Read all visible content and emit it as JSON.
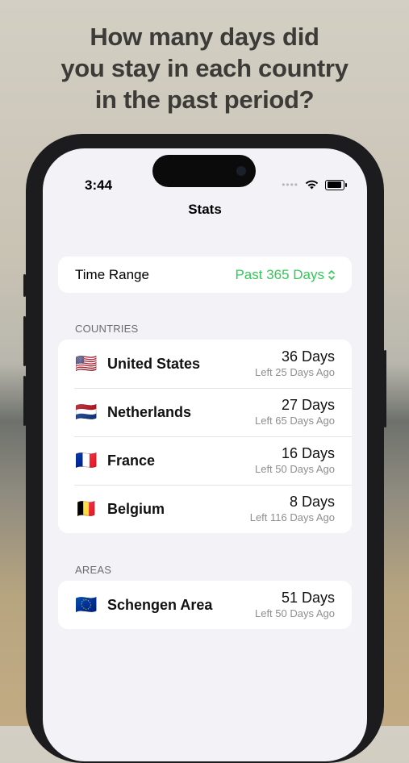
{
  "headline": {
    "line1": "How many days did",
    "line2": "you stay in each country",
    "line3": "in the past period?"
  },
  "status_bar": {
    "time": "3:44",
    "signal_dots": "••••",
    "wifi_icon": "wifi-icon",
    "battery_icon": "battery-icon"
  },
  "nav": {
    "title": "Stats"
  },
  "time_range": {
    "label": "Time Range",
    "value": "Past 365 Days",
    "accent_color": "#34c759"
  },
  "countries": {
    "header": "COUNTRIES",
    "items": [
      {
        "flag": "🇺🇸",
        "name": "United States",
        "days": "36 Days",
        "left": "Left 25 Days Ago"
      },
      {
        "flag": "🇳🇱",
        "name": "Netherlands",
        "days": "27 Days",
        "left": "Left 65 Days Ago"
      },
      {
        "flag": "🇫🇷",
        "name": "France",
        "days": "16 Days",
        "left": "Left 50 Days Ago"
      },
      {
        "flag": "🇧🇪",
        "name": "Belgium",
        "days": "8 Days",
        "left": "Left 116 Days Ago"
      }
    ]
  },
  "areas": {
    "header": "AREAS",
    "items": [
      {
        "flag": "🇪🇺",
        "name": "Schengen Area",
        "days": "51 Days",
        "left": "Left 50 Days Ago"
      }
    ]
  }
}
